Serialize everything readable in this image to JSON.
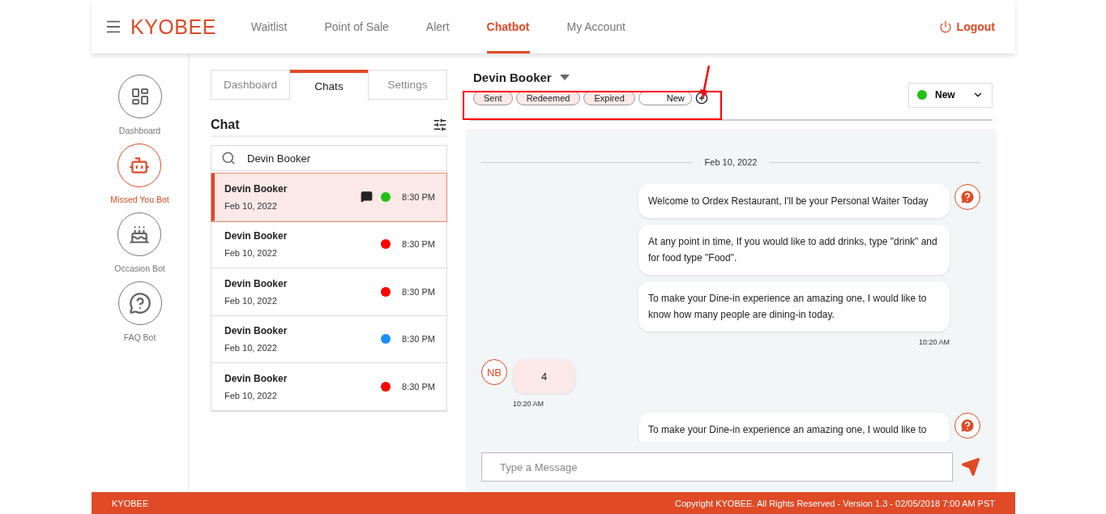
{
  "header": {
    "brand": "KYOBEE",
    "nav": [
      {
        "label": "Waitlist",
        "selected": false
      },
      {
        "label": "Point of Sale",
        "selected": false
      },
      {
        "label": "Alert",
        "selected": false
      },
      {
        "label": "Chatbot",
        "selected": true
      },
      {
        "label": "My Account",
        "selected": false
      }
    ],
    "logout": "Logout"
  },
  "sidebar": {
    "items": [
      {
        "label": "Dashboard",
        "kind": "dashboard",
        "selected": false
      },
      {
        "label": "Missed You Bot",
        "kind": "robot",
        "selected": true
      },
      {
        "label": "Occasion Bot",
        "kind": "cake",
        "selected": false
      },
      {
        "label": "FAQ Bot",
        "kind": "faq",
        "selected": false
      }
    ]
  },
  "chat_list": {
    "tabs": [
      {
        "label": "Dashboard",
        "selected": false
      },
      {
        "label": "Chats",
        "selected": true
      },
      {
        "label": "Settings",
        "selected": false
      }
    ],
    "title": "Chat",
    "search": {
      "value": "Devin Booker"
    },
    "items": [
      {
        "name": "Devin Booker",
        "date": "Feb 10, 2022",
        "time": "8:30 PM",
        "color": "#22c011",
        "selected": true,
        "unread": true
      },
      {
        "name": "Devin Booker",
        "date": "Feb 10, 2022",
        "time": "8:30 PM",
        "color": "#ff0000",
        "selected": false,
        "unread": false
      },
      {
        "name": "Devin Booker",
        "date": "Feb 10, 2022",
        "time": "8:30 PM",
        "color": "#ff0000",
        "selected": false,
        "unread": false
      },
      {
        "name": "Devin Booker",
        "date": "Feb 10, 2022",
        "time": "8:30 PM",
        "color": "#1a8cff",
        "selected": false,
        "unread": false
      },
      {
        "name": "Devin Booker",
        "date": "Feb 10, 2022",
        "time": "8:30 PM",
        "color": "#ff0000",
        "selected": false,
        "unread": false
      }
    ]
  },
  "conversation": {
    "contact": "Devin Booker",
    "tags": [
      {
        "label": "Sent",
        "kind": "tag"
      },
      {
        "label": "Redeemed",
        "kind": "tag"
      },
      {
        "label": "Expired",
        "kind": "tag"
      },
      {
        "label": "New",
        "kind": "input"
      }
    ],
    "status": {
      "label": "New",
      "color": "#22c011"
    },
    "date_divider": "Feb 10, 2022",
    "messages": [
      {
        "kind": "bot",
        "bubbles": [
          "Welcome to Ordex Restaurant, I'll be your Personal Waiter Today",
          "At any point in time, If you would like to add drinks, type \"drink\" and for food type \"Food\".",
          "To make your Dine-in experience an amazing one, I would like to know how many people are dining-in today."
        ],
        "time": "10:20 AM"
      },
      {
        "kind": "user",
        "avatar": "NB",
        "bubbles": [
          "4"
        ],
        "time": "10:20 AM"
      },
      {
        "kind": "bot",
        "bubbles": [
          "To make your Dine-in experience an amazing one, I would like to"
        ]
      }
    ],
    "composer": {
      "placeholder": "Type a Message"
    }
  },
  "footer": {
    "brand": "KYOBEE",
    "copyright": "Copyright KYOBEE. All Rights Reserved - Version 1.3 - 02/05/2018 7:00 AM PST"
  }
}
